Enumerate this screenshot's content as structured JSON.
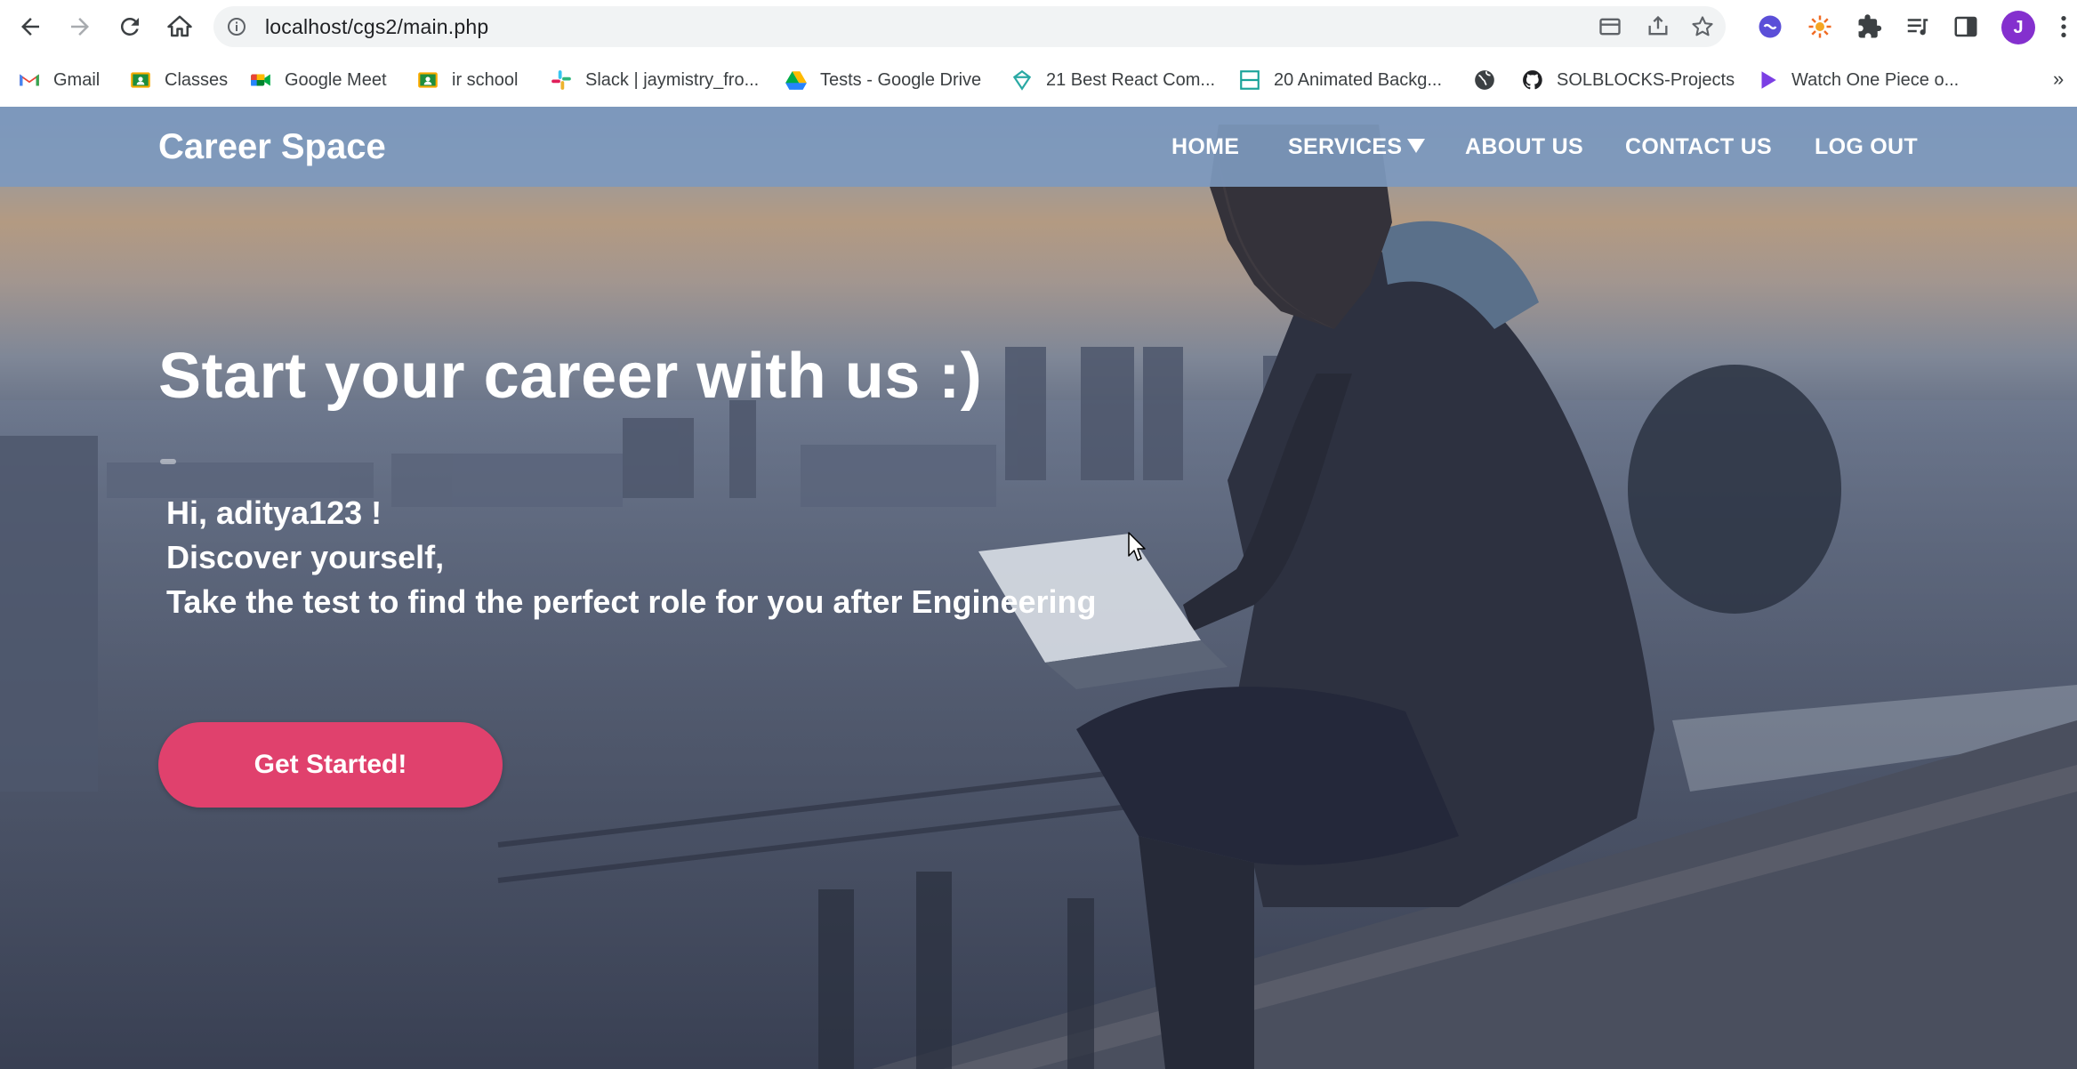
{
  "browser": {
    "url": "localhost/cgs2/main.php",
    "profile_initial": "J",
    "bookmarks": [
      {
        "label": "Gmail",
        "icon": "gmail-icon"
      },
      {
        "label": "Classes",
        "icon": "classroom-icon"
      },
      {
        "label": "Google Meet",
        "icon": "meet-icon"
      },
      {
        "label": "ir school",
        "icon": "classroom-icon"
      },
      {
        "label": "Slack | jaymistry_fro...",
        "icon": "slack-icon"
      },
      {
        "label": "Tests - Google Drive",
        "icon": "drive-icon"
      },
      {
        "label": "21 Best React Com...",
        "icon": "react-site-icon"
      },
      {
        "label": "20 Animated Backg...",
        "icon": "layout-icon"
      },
      {
        "label": "",
        "icon": "globe-icon"
      },
      {
        "label": "SOLBLOCKS-Projects",
        "icon": "github-icon"
      },
      {
        "label": "Watch One Piece o...",
        "icon": "play-icon"
      }
    ],
    "bookmarks_more": "»"
  },
  "site": {
    "brand": "Career Space",
    "nav": {
      "home": "HOME",
      "services": "SERVICES",
      "about": "ABOUT US",
      "contact": "CONTACT US",
      "logout": "LOG OUT"
    },
    "hero": {
      "title": "Start your career with us :)",
      "greeting": "Hi, aditya123 !",
      "line2": "Discover yourself,",
      "line3": "Take the test to find the perfect role for you after Engineering",
      "cta": "Get Started!"
    }
  },
  "colors": {
    "navbar": "#7d99be",
    "cta": "#e0416d",
    "profile": "#8430ce"
  }
}
